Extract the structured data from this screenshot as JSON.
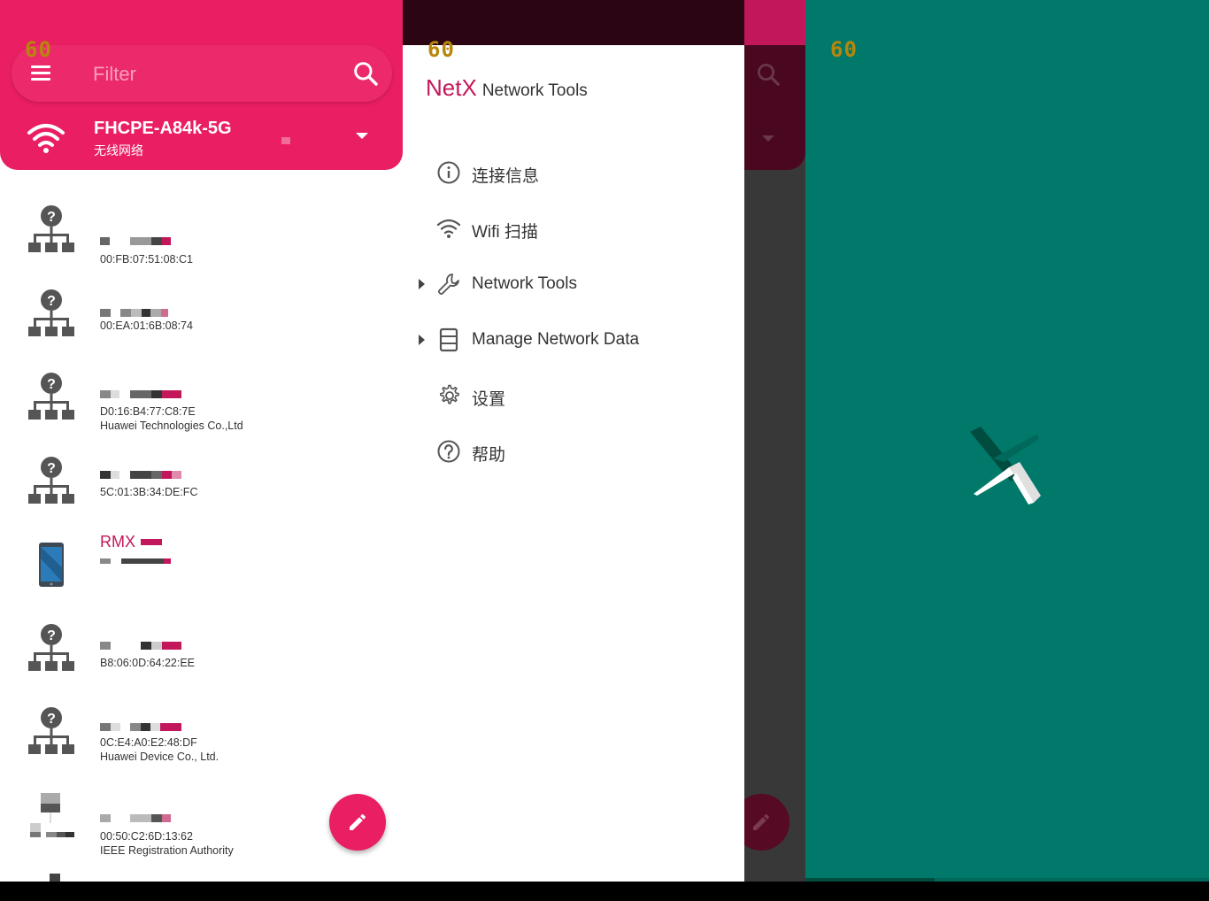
{
  "status_overlay": {
    "fps": "60"
  },
  "search": {
    "placeholder": "Filter"
  },
  "network": {
    "ssid": "FHCPE-A84k-5G",
    "type": "无线网络"
  },
  "devices": [
    {
      "name": "",
      "mac": "00:FB:07:51:08:C1",
      "vendor": "",
      "icon": "unknown-network-device-icon"
    },
    {
      "name": "",
      "mac": "00:EA:01:6B:08:74",
      "vendor": "",
      "icon": "unknown-network-device-icon"
    },
    {
      "name": "",
      "mac": "D0:16:B4:77:C8:7E",
      "vendor": "Huawei Technologies Co.,Ltd",
      "icon": "unknown-network-device-icon"
    },
    {
      "name": "",
      "mac": "5C:01:3B:34:DE:FC",
      "vendor": "",
      "icon": "unknown-network-device-icon"
    },
    {
      "name": "RMX",
      "mac": "",
      "vendor": "",
      "icon": "phone-icon"
    },
    {
      "name": "",
      "mac": "B8:06:0D:64:22:EE",
      "vendor": "",
      "icon": "unknown-network-device-icon"
    },
    {
      "name": "",
      "mac": "0C:E4:A0:E2:48:DF",
      "vendor": "Huawei Device Co., Ltd.",
      "icon": "unknown-network-device-icon"
    },
    {
      "name": "",
      "mac": "00:50:C2:6D:13:62",
      "vendor": "IEEE Registration Authority",
      "icon": "pixelated-device-icon"
    }
  ],
  "drawer": {
    "brand": "NetX",
    "brand_sub": "Network Tools",
    "items": [
      {
        "label": "连接信息",
        "icon": "info-icon",
        "expandable": false
      },
      {
        "label": "Wifi 扫描",
        "icon": "wifi-icon",
        "expandable": false
      },
      {
        "label": "Network Tools",
        "icon": "wrench-icon",
        "expandable": true
      },
      {
        "label": "Manage Network Data",
        "icon": "database-icon",
        "expandable": true
      },
      {
        "label": "设置",
        "icon": "gear-icon",
        "expandable": false
      },
      {
        "label": "帮助",
        "icon": "help-icon",
        "expandable": false
      }
    ]
  },
  "colors": {
    "primary": "#e91e63",
    "primary_dark": "#c2185b",
    "splash_background": "#00796b"
  }
}
